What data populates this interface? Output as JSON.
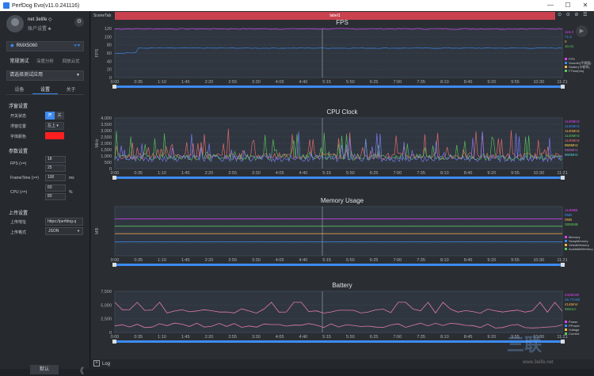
{
  "window": {
    "title": "PerfDog Evo(v11.0.241116)",
    "controls": [
      "—",
      "☐",
      "✕"
    ]
  },
  "user": {
    "name": "net 3elife ◇",
    "status": "账户设置 ♣",
    "settings_icon": "⚙"
  },
  "device": {
    "name": "RMX5060",
    "icon": "◆",
    "wifi_icon": "ᯤ▾"
  },
  "mode_tabs": [
    "常规测试",
    "深度分析",
    "回放云优"
  ],
  "app_select": {
    "placeholder": "请选择测试应用",
    "caret": "▼"
  },
  "sub_tabs": [
    "设备",
    "设置",
    "关于"
  ],
  "float_settings": {
    "title": "浮窗设置",
    "toggle_label": "开关状态",
    "toggle_on": "开",
    "toggle_off": "关",
    "position_label": "浮窗位置",
    "position_value": "左上 ▾",
    "font_color_label": "字体颜色",
    "font_color": "#ff1f1f"
  },
  "params": {
    "title": "参数设置",
    "fps_label": "FPS (>=)",
    "fps_values": [
      "18",
      "25"
    ],
    "frametime_label": "FrameTime (>=)",
    "frametime_value": "100",
    "frametime_unit": "ms",
    "cpu_label": "CPU (>=)",
    "cpu_values": [
      "60",
      "80"
    ],
    "cpu_unit": "%"
  },
  "upload": {
    "title": "上传设置",
    "url_label": "上传地址",
    "url_value": "https://perfdog.q",
    "format_label": "上传格式",
    "format_value": "JSON"
  },
  "bottom": {
    "default_button": "默认",
    "collapse_icon": "《"
  },
  "scene": {
    "tab": "SceneTab",
    "label": "label1",
    "icons": "⊙ ⊙ ⊘ ☰"
  },
  "status": {
    "log_label": "Log",
    "plus_icon": "+"
  },
  "watermark": {
    "text": "三联",
    "url": "www.3elife.net"
  },
  "chart_data": [
    {
      "type": "line",
      "title": "FPS",
      "ylabel": "FPS",
      "ylim": [
        0,
        120
      ],
      "yticks": [
        "0",
        "20",
        "40",
        "60",
        "80",
        "100",
        "120"
      ],
      "x_ticks": [
        "0:00",
        "0:35",
        "1:10",
        "1:45",
        "2:20",
        "2:55",
        "3:30",
        "4:05",
        "4:40",
        "5:15",
        "5:50",
        "6:25",
        "7:00",
        "7:35",
        "8:10",
        "8:45",
        "9:20",
        "9:55",
        "10:30",
        "11:21"
      ],
      "series": [
        {
          "name": "FPS",
          "color": "#e040fb",
          "level": 119
        },
        {
          "name": "Smooth",
          "color": "#3d8bf2",
          "level": 72
        }
      ],
      "legend": [
        "FPS",
        "Smooth(平滑值)",
        "Stutter(卡顿率)",
        "FTime(ms)"
      ],
      "right_values": [
        "119.3",
        "71.6",
        "0",
        "10.01"
      ]
    },
    {
      "type": "line",
      "title": "CPU Clock",
      "ylabel": "MHz",
      "ylim": [
        0,
        4000
      ],
      "yticks": [
        "0",
        "500",
        "1,000",
        "1,500",
        "2,000",
        "2,500",
        "3,000",
        "3,500",
        "4,000"
      ],
      "x_ticks": [
        "0:00",
        "0:35",
        "1:10",
        "1:45",
        "2:20",
        "2:55",
        "3:30",
        "4:05",
        "4:40",
        "5:15",
        "5:50",
        "6:25",
        "7:00",
        "7:35",
        "8:10",
        "8:45",
        "9:20",
        "9:55",
        "10:30",
        "11:21"
      ],
      "series": [
        {
          "name": "CPU0",
          "color": "#f07070",
          "level": 1000
        },
        {
          "name": "CPU1",
          "color": "#5cc85c",
          "level": 900
        },
        {
          "name": "CPU2",
          "color": "#8080ff",
          "level": 800
        }
      ],
      "right_values": [
        "1140MHz",
        "1140MHz",
        "1140MHz",
        "1140MHz",
        "1140MHz",
        "960MHz",
        "960MHz",
        "960MHz"
      ]
    },
    {
      "type": "line",
      "title": "Memory Usage",
      "ylabel": "MB",
      "x_ticks": [
        "0:00",
        "0:35",
        "1:10",
        "1:45",
        "2:20",
        "2:55",
        "3:30",
        "4:05",
        "4:40",
        "5:15",
        "5:50",
        "6:25",
        "7:00",
        "7:35",
        "8:10",
        "8:45",
        "9:20",
        "9:55",
        "10:30",
        "11:21"
      ],
      "legend": [
        "Memory",
        "SwapMemory",
        "VirtualMemory",
        "AvailableMemory"
      ],
      "right_values": [
        "1146MB",
        "0MB",
        "0MB",
        "3959MB"
      ]
    },
    {
      "type": "line",
      "title": "Battery",
      "ylim": [
        0,
        7500
      ],
      "yticks": [
        "0",
        "2,500",
        "5,000",
        "7,500"
      ],
      "x_ticks": [
        "0:00",
        "0:35",
        "1:10",
        "1:45",
        "2:20",
        "2:55",
        "3:30",
        "4:05",
        "4:40",
        "5:15",
        "5:50",
        "6:25",
        "7:00",
        "7:35",
        "8:10",
        "8:45",
        "9:20",
        "9:55",
        "10:30",
        "11:21"
      ],
      "legend": [
        "Power",
        "PPower",
        "Voltage",
        "Current"
      ],
      "right_values": [
        "2425mW",
        "35.77mW",
        "4148mV",
        "584mA"
      ]
    }
  ]
}
